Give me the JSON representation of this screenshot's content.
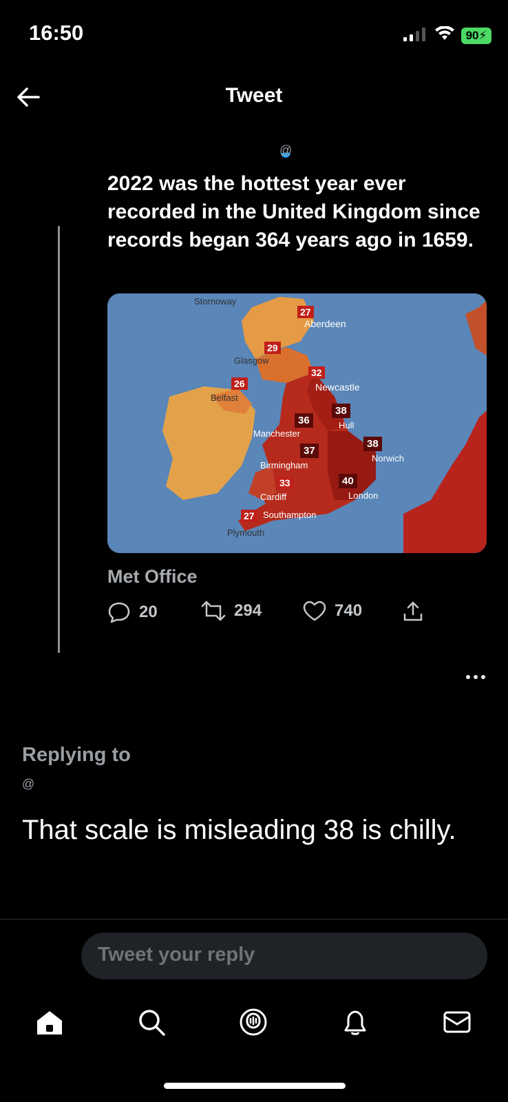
{
  "status_bar": {
    "time": "16:50",
    "battery": "90"
  },
  "header": {
    "title": "Tweet"
  },
  "quoted_tweet": {
    "handle_fragment": "@",
    "text": "2022 was the hottest year ever recorded in the United Kingdom since records began 364 years ago in 1659.",
    "source": "Met Office",
    "map": {
      "cities": [
        {
          "name": "Stornoway",
          "temp": ""
        },
        {
          "name": "Aberdeen",
          "temp": "27"
        },
        {
          "name": "Glasgow",
          "temp": "29"
        },
        {
          "name": "Belfast",
          "temp": "26"
        },
        {
          "name": "Newcastle",
          "temp": "32"
        },
        {
          "name": "Hull",
          "temp": "38"
        },
        {
          "name": "Manchester",
          "temp": "36"
        },
        {
          "name": "Birmingham",
          "temp": "37"
        },
        {
          "name": "Norwich",
          "temp": "38"
        },
        {
          "name": "Cardiff",
          "temp": "33"
        },
        {
          "name": "London",
          "temp": "40"
        },
        {
          "name": "Southampton",
          "temp": "27"
        },
        {
          "name": "Plymouth",
          "temp": ""
        }
      ]
    },
    "stats": {
      "replies": "20",
      "retweets": "294",
      "likes": "740"
    }
  },
  "reply": {
    "replying_to": "Replying to",
    "handle_fragment": "@",
    "text": "That scale is misleading 38 is chilly."
  },
  "composer": {
    "placeholder": "Tweet your reply"
  },
  "colors": {
    "accent": "#1d9bf0",
    "background": "#000000",
    "battery": "#4cd964"
  },
  "icons": [
    "back-arrow-icon",
    "reply-icon",
    "retweet-icon",
    "like-icon",
    "share-icon",
    "more-icon",
    "home-icon",
    "search-icon",
    "spaces-icon",
    "notifications-icon",
    "messages-icon"
  ]
}
